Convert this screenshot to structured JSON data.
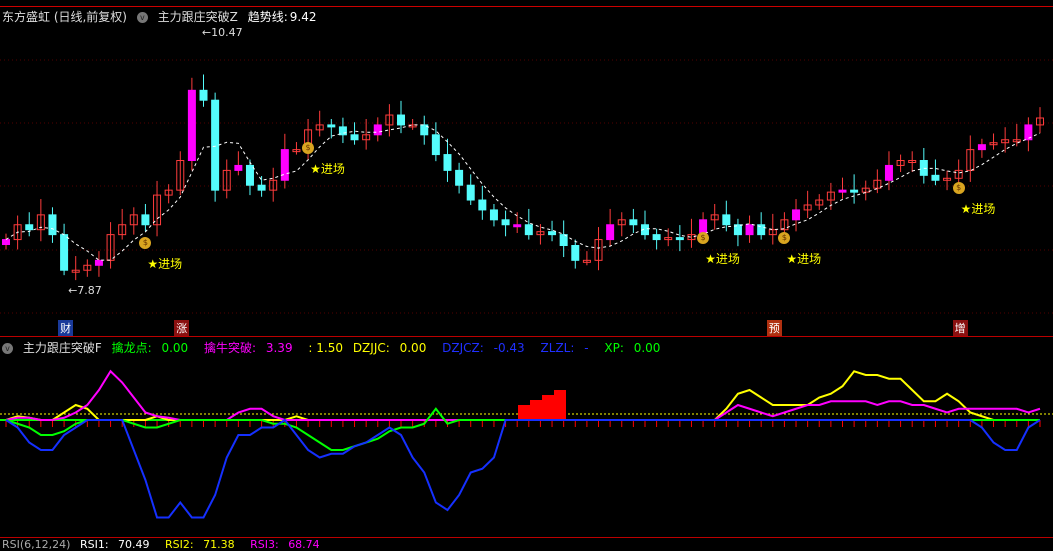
{
  "main_header": {
    "stock": "东方盛虹 (日线,前复权)",
    "indicator": "主力跟庄突破Z",
    "trend_label": "趋势线:",
    "trend_value": "9.42"
  },
  "price_labels": {
    "high": "10.47",
    "low": "7.87"
  },
  "signals": [
    {
      "label": "★进场",
      "i": 12
    },
    {
      "label": "★进场",
      "i": 26
    },
    {
      "label": "★进场",
      "i": 60
    },
    {
      "label": "★进场",
      "i": 67
    },
    {
      "label": "★进场",
      "i": 82
    }
  ],
  "event_tags": [
    {
      "label": "财",
      "i": 5,
      "color": "#1a3a9a"
    },
    {
      "label": "涨",
      "i": 15,
      "color": "#8a1010"
    },
    {
      "label": "预",
      "i": 66,
      "color": "#b03010"
    },
    {
      "label": "增",
      "i": 82,
      "color": "#8a1010"
    }
  ],
  "colors": {
    "up": "#ff3c3c",
    "down": "#54fcfc",
    "signal": "#ff00ff"
  },
  "closes": [
    8.37,
    8.52,
    8.47,
    8.62,
    8.42,
    8.06,
    8.06,
    8.11,
    8.16,
    8.42,
    8.52,
    8.62,
    8.52,
    8.82,
    8.87,
    9.17,
    9.88,
    9.78,
    8.87,
    9.07,
    9.12,
    8.92,
    8.87,
    8.97,
    9.28,
    9.28,
    9.48,
    9.53,
    9.51,
    9.43,
    9.38,
    9.43,
    9.53,
    9.63,
    9.53,
    9.53,
    9.43,
    9.23,
    9.07,
    8.92,
    8.77,
    8.67,
    8.57,
    8.52,
    8.52,
    8.42,
    8.45,
    8.42,
    8.31,
    8.16,
    8.16,
    8.37,
    8.52,
    8.57,
    8.52,
    8.42,
    8.37,
    8.39,
    8.37,
    8.42,
    8.57,
    8.62,
    8.52,
    8.42,
    8.52,
    8.42,
    8.47,
    8.57,
    8.67,
    8.72,
    8.77,
    8.85,
    8.87,
    8.85,
    8.89,
    8.97,
    9.12,
    9.17,
    9.17,
    9.02,
    8.97,
    8.99,
    9.07,
    9.28,
    9.33,
    9.35,
    9.38,
    9.38,
    9.53,
    9.6
  ],
  "sub_header": {
    "indicator": "主力跟庄突破F",
    "a_label": "擒龙点:",
    "a_value": "0.00",
    "b_label": "擒牛突破:",
    "b_value": "3.39",
    "c_value": ": 1.50",
    "d_label": "DZJJC:",
    "d_value": "0.00",
    "e_label": "DZJCZ:",
    "e_value": "-0.43",
    "f_label": "ZLZL:",
    "f_value": "-",
    "g_label": "XP:",
    "g_value": "0.00"
  },
  "sub_series": {
    "yellow": [
      0,
      0.5,
      0.3,
      0,
      0,
      1,
      2,
      1.5,
      0,
      0,
      0,
      0,
      0,
      0.5,
      0,
      0,
      0,
      0,
      0,
      0,
      0,
      0,
      0,
      0,
      0,
      0.5,
      0,
      0,
      0,
      0,
      0,
      0,
      0,
      0,
      0,
      0,
      0,
      0,
      0,
      0,
      0,
      0,
      0,
      0,
      0,
      0,
      0,
      0,
      0,
      0,
      0,
      0,
      0,
      0,
      0,
      0,
      0,
      0,
      0,
      0,
      0,
      0,
      1.5,
      3.5,
      4,
      3,
      2,
      2,
      2,
      2,
      3,
      3.5,
      4.5,
      6.5,
      6,
      6,
      5.5,
      5.5,
      4,
      2.5,
      2.5,
      3.5,
      2.5,
      1,
      0.5,
      0,
      0,
      0,
      0,
      0
    ],
    "magenta": [
      0,
      0.3,
      0.3,
      0,
      0,
      0.3,
      1,
      2,
      4,
      6.5,
      5,
      3,
      1,
      0.5,
      0.3,
      0,
      0,
      0,
      0,
      0,
      1,
      1.5,
      1.5,
      0.5,
      0,
      0,
      0,
      0,
      0,
      0,
      0,
      0,
      0,
      0,
      0,
      0,
      0,
      0,
      0,
      0,
      0,
      0,
      0,
      0,
      0,
      0,
      0,
      0,
      0,
      0,
      0,
      0,
      0,
      0,
      0,
      0,
      0,
      0,
      0,
      0,
      0,
      0,
      1,
      2,
      1.5,
      1,
      0.5,
      1,
      1.5,
      2,
      2,
      2.5,
      2.5,
      2.5,
      2.5,
      2,
      2.5,
      2.5,
      2,
      2,
      1.5,
      1,
      1.5,
      1.5,
      1.5,
      1.5,
      1.5,
      1.5,
      1,
      1.5
    ],
    "green": [
      0,
      -0.5,
      -1,
      -2,
      -2,
      -1.5,
      -0.5,
      0,
      0,
      0,
      0,
      -0.5,
      -1,
      -1,
      -0.5,
      0,
      0,
      0,
      0,
      0,
      0,
      0,
      0,
      -0.5,
      -0.5,
      -1,
      -2,
      -3,
      -4,
      -4,
      -3.5,
      -3,
      -2.5,
      -1.5,
      -1,
      -1,
      -0.5,
      1.5,
      -0.5,
      0,
      0,
      0,
      0,
      0,
      0,
      0,
      0,
      0,
      0,
      0,
      0,
      0,
      0,
      0,
      0,
      0,
      0,
      0,
      0,
      0,
      0,
      0,
      0,
      0,
      0,
      0,
      0,
      0,
      0,
      0,
      0,
      0,
      0,
      0,
      0,
      0,
      0,
      0,
      0,
      0,
      0,
      0,
      0,
      0,
      0,
      0,
      0,
      0,
      0,
      0
    ],
    "blue": [
      0,
      -1,
      -3,
      -4,
      -4,
      -2,
      -1,
      0,
      0,
      0,
      0,
      -4,
      -8,
      -13,
      -13,
      -11,
      -13,
      -13,
      -10,
      -5,
      -2,
      -2,
      -1,
      -1,
      0,
      -2,
      -4,
      -5,
      -4.5,
      -4.5,
      -3.5,
      -3,
      -2,
      -1,
      -2,
      -5,
      -7,
      -11,
      -12,
      -10,
      -7,
      -6.5,
      -5,
      0,
      0,
      0,
      0,
      0,
      0,
      0,
      0,
      0,
      0,
      0,
      0,
      0,
      0,
      0,
      0,
      0,
      0,
      0,
      0,
      0,
      0,
      0,
      0,
      0,
      0,
      0,
      0,
      0,
      0,
      0,
      0,
      0,
      0,
      0,
      0,
      0,
      0,
      0,
      0,
      0,
      -1,
      -3,
      -4,
      -4,
      -1,
      0
    ]
  },
  "sub_bars": [
    3,
    4,
    5,
    6
  ],
  "bottom_header": {
    "indicator": "RSI(6,12,24)",
    "r1_label": "RSI1:",
    "r1_value": "70.49",
    "r2_label": "RSI2:",
    "r2_value": "71.38",
    "r3_label": "RSI3:",
    "r3_value": "68.74"
  }
}
